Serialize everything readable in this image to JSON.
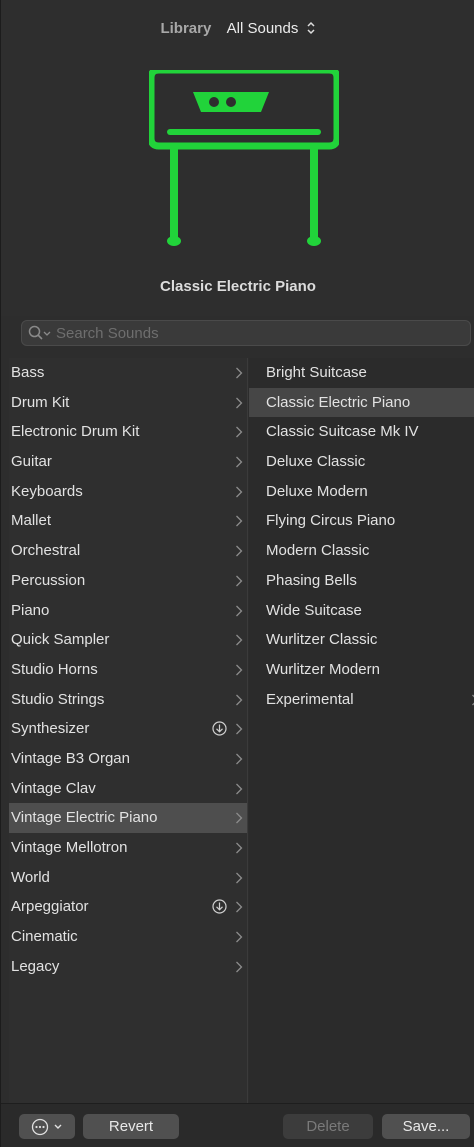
{
  "header": {
    "library_label": "Library",
    "library_selection": "All Sounds",
    "patch_name": "Classic Electric Piano",
    "icon_color": "#21d33a"
  },
  "search": {
    "placeholder": "Search Sounds",
    "value": ""
  },
  "categories": [
    {
      "label": "Bass"
    },
    {
      "label": "Drum Kit"
    },
    {
      "label": "Electronic Drum Kit"
    },
    {
      "label": "Guitar"
    },
    {
      "label": "Keyboards"
    },
    {
      "label": "Mallet"
    },
    {
      "label": "Orchestral"
    },
    {
      "label": "Percussion"
    },
    {
      "label": "Piano"
    },
    {
      "label": "Quick Sampler"
    },
    {
      "label": "Studio Horns"
    },
    {
      "label": "Studio Strings"
    },
    {
      "label": "Synthesizer",
      "download": true
    },
    {
      "label": "Vintage B3 Organ"
    },
    {
      "label": "Vintage Clav"
    },
    {
      "label": "Vintage Electric Piano",
      "selected": true
    },
    {
      "label": "Vintage Mellotron"
    },
    {
      "label": "World"
    },
    {
      "label": "Arpeggiator",
      "download": true
    },
    {
      "label": "Cinematic"
    },
    {
      "label": "Legacy"
    }
  ],
  "patches": [
    {
      "label": "Bright Suitcase"
    },
    {
      "label": "Classic Electric Piano",
      "selected": true
    },
    {
      "label": "Classic Suitcase Mk IV"
    },
    {
      "label": "Deluxe Classic"
    },
    {
      "label": "Deluxe Modern"
    },
    {
      "label": "Flying Circus Piano"
    },
    {
      "label": "Modern Classic"
    },
    {
      "label": "Phasing Bells"
    },
    {
      "label": "Wide Suitcase"
    },
    {
      "label": "Wurlitzer Classic"
    },
    {
      "label": "Wurlitzer Modern"
    },
    {
      "label": "Experimental",
      "folder": true
    }
  ],
  "footer": {
    "revert_label": "Revert",
    "delete_label": "Delete",
    "save_label": "Save..."
  }
}
